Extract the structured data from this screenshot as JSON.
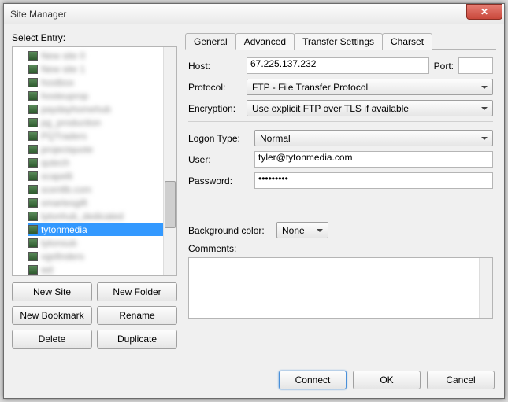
{
  "window": {
    "title": "Site Manager"
  },
  "leftPane": {
    "label": "Select Entry:",
    "entries": [
      {
        "name": "New site 0",
        "blur": true
      },
      {
        "name": "New site 1",
        "blur": true
      },
      {
        "name": "hostbox",
        "blur": true
      },
      {
        "name": "hosteuprop",
        "blur": true
      },
      {
        "name": "paydayhomehub",
        "blur": true
      },
      {
        "name": "pg_production",
        "blur": true
      },
      {
        "name": "PQTraders",
        "blur": true
      },
      {
        "name": "projectquote",
        "blur": true
      },
      {
        "name": "qutech",
        "blur": true
      },
      {
        "name": "scapelli",
        "blur": true
      },
      {
        "name": "scentlb.com",
        "blur": true
      },
      {
        "name": "smartesgift",
        "blur": true
      },
      {
        "name": "tytonhub_dedicated",
        "blur": true
      },
      {
        "name": "tytonmedia",
        "blur": false,
        "selected": true
      },
      {
        "name": "tytonsub",
        "blur": true
      },
      {
        "name": "vgsfinders",
        "blur": true
      },
      {
        "name": "wd",
        "blur": true
      }
    ],
    "buttons": {
      "newSite": "New Site",
      "newFolder": "New Folder",
      "newBookmark": "New Bookmark",
      "rename": "Rename",
      "delete": "Delete",
      "duplicate": "Duplicate"
    }
  },
  "tabs": {
    "general": "General",
    "advanced": "Advanced",
    "transfer": "Transfer Settings",
    "charset": "Charset"
  },
  "form": {
    "hostLabel": "Host:",
    "host": "67.225.137.232",
    "portLabel": "Port:",
    "port": "",
    "protocolLabel": "Protocol:",
    "protocol": "FTP - File Transfer Protocol",
    "encryptionLabel": "Encryption:",
    "encryption": "Use explicit FTP over TLS if available",
    "logonLabel": "Logon Type:",
    "logon": "Normal",
    "userLabel": "User:",
    "user": "tyler@tytonmedia.com",
    "passLabel": "Password:",
    "pass": "•••••••••",
    "bgLabel": "Background color:",
    "bg": "None",
    "commentsLabel": "Comments:"
  },
  "footer": {
    "connect": "Connect",
    "ok": "OK",
    "cancel": "Cancel"
  }
}
